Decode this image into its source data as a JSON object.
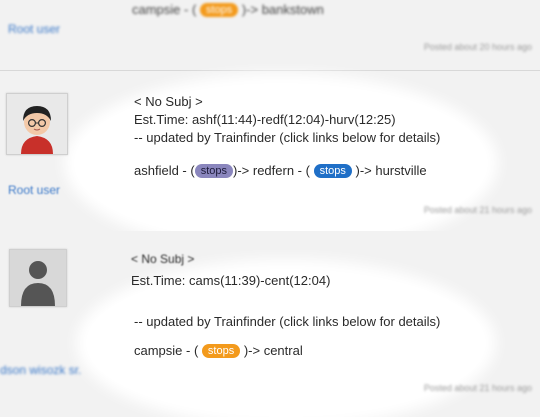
{
  "post1": {
    "route_from": "campsie - (",
    "badge": "stops",
    "route_to": ")-> bankstown",
    "user": "Root user",
    "posted": "Posted about 20 hours ago"
  },
  "post2": {
    "subject": "< No Subj >",
    "est_time": "Est.Time: ashf(11:44)-redf(12:04)-hurv(12:25)",
    "updated": "-- updated by Trainfinder (click links below for details)",
    "seg1_from": "ashfield - (",
    "badge1": "stops",
    "seg1_to": ")-> redfern - (",
    "badge2": "stops",
    "seg2_to": ")-> hurstville",
    "user": "Root user",
    "posted": "Posted about 21 hours ago"
  },
  "post3": {
    "subject": "< No Subj >",
    "est_time": "Est.Time: cams(11:39)-cent(12:04)",
    "updated": "-- updated by Trainfinder (click links below for details)",
    "route_from": "campsie - (",
    "badge": "stops",
    "route_to": ")-> central",
    "user": "dson wisozk sr.",
    "posted": "Posted about 21 hours ago"
  },
  "colors": {
    "link": "#3a78c8",
    "badge_orange": "#f39a1c",
    "badge_purple": "#8a86bd",
    "badge_blue": "#1f6fc7"
  }
}
